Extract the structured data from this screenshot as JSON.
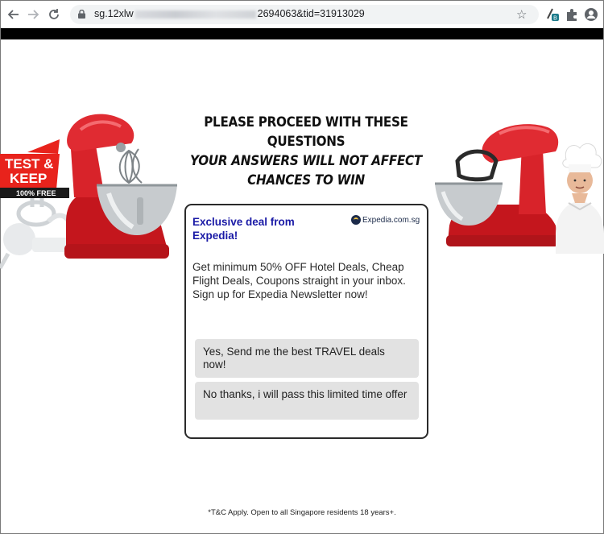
{
  "browser": {
    "url_prefix": "sg.12xlw",
    "url_suffix": "2694063&tid=31913029"
  },
  "headline": {
    "line1": "PLEASE PROCEED WITH THESE",
    "line2": "QUESTIONS",
    "line3": "YOUR ANSWERS WILL NOT AFFECT",
    "line4": "CHANCES TO WIN"
  },
  "promo_badge": {
    "line1": "TEST &",
    "line2": "KEEP",
    "line3": "100% FREE"
  },
  "card": {
    "title": "Exclusive deal from Expedia!",
    "brand": "Expedia.com.sg",
    "body": "Get minimum 50% OFF Hotel Deals, Cheap Flight Deals, Coupons straight in your inbox. Sign up for Expedia Newsletter now!",
    "options": [
      "Yes, Send me the best TRAVEL deals now!",
      "No thanks, i will pass this limited time offer"
    ]
  },
  "footer": "*T&C Apply. Open to all Singapore residents 18 years+.",
  "colors": {
    "card_title": "#1a1aa6",
    "option_bg": "#e2e2e2",
    "mixer_red": "#d8232a",
    "badge_red": "#e8231c"
  }
}
